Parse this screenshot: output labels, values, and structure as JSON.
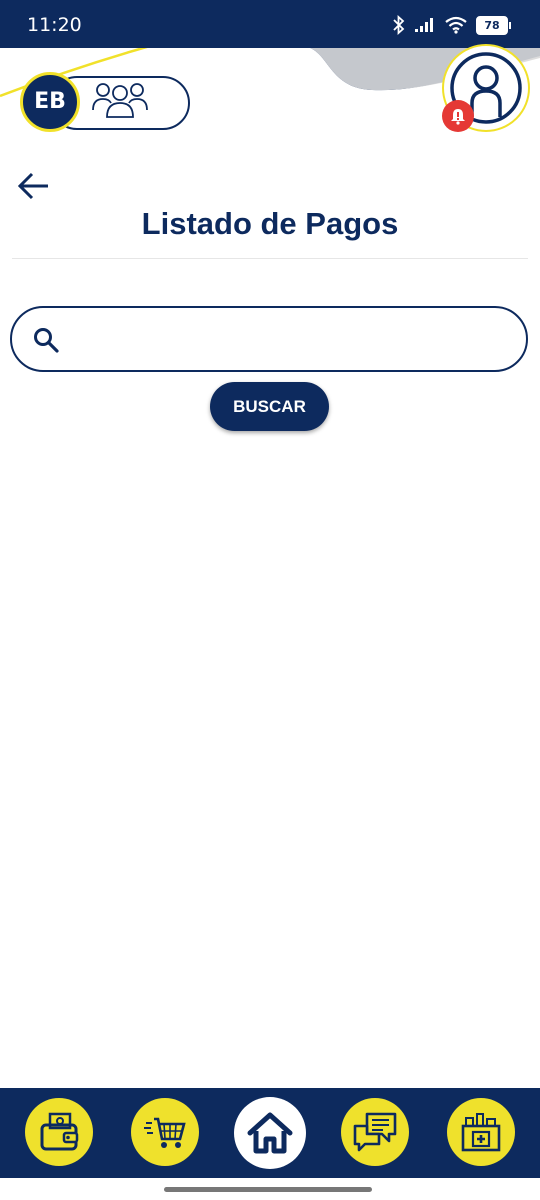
{
  "status_bar": {
    "time": "11:20",
    "battery": "78"
  },
  "header": {
    "logo_text": "EB"
  },
  "page": {
    "title": "Listado de Pagos"
  },
  "search": {
    "placeholder": "",
    "value": "",
    "button_label": "BUSCAR"
  },
  "bottom_nav": {
    "items": [
      {
        "icon": "wallet-icon"
      },
      {
        "icon": "cart-icon"
      },
      {
        "icon": "home-icon",
        "active": true
      },
      {
        "icon": "chat-icon"
      },
      {
        "icon": "pharmacy-icon"
      }
    ]
  },
  "colors": {
    "primary": "#0d2a5e",
    "accent": "#efe12c",
    "alert": "#e53935"
  }
}
